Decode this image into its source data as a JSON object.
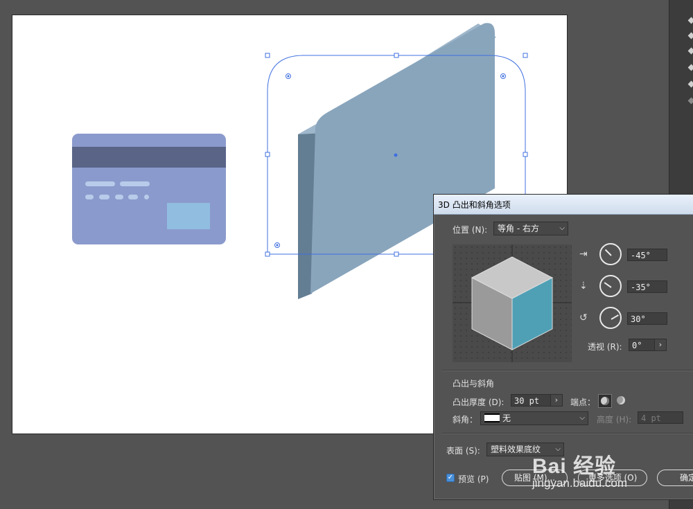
{
  "dialog": {
    "title": "3D 凸出和斜角选项",
    "position_label": "位置 (N):",
    "position_value": "等角 - 右方",
    "rotation_x": "-45°",
    "rotation_y": "-35°",
    "rotation_z": "30°",
    "perspective_label": "透视 (R):",
    "perspective_value": "0°",
    "extrude_section": "凸出与斜角",
    "extrude_depth_label": "凸出厚度 (D):",
    "extrude_depth_value": "30 pt",
    "cap_label": "端点：",
    "bevel_label": "斜角：",
    "bevel_value": "无",
    "height_label": "高度 (H):",
    "height_value": "4 pt",
    "surface_label": "表面 (S):",
    "surface_value": "塑料效果底纹",
    "preview_label": "预览 (P)",
    "preview_checked": true,
    "map_button": "贴图 (M)...",
    "more_options_button": "更多选项 (O)",
    "ok_button": "确定"
  },
  "watermark": {
    "logo": "Bai 经验",
    "url": "jingyan.baidu.com"
  },
  "colors": {
    "card_body": "#8b9acc",
    "card_stripe": "#596487",
    "card_chip": "#91bde1",
    "extrude_front": "#89a5bc",
    "extrude_side": "#637d92",
    "extrude_top": "#9fb7cb",
    "selection": "#3f6fe0",
    "cube_top": "#c8c8c8",
    "cube_left": "#9a9a9a",
    "cube_right": "#4fa0b5"
  }
}
